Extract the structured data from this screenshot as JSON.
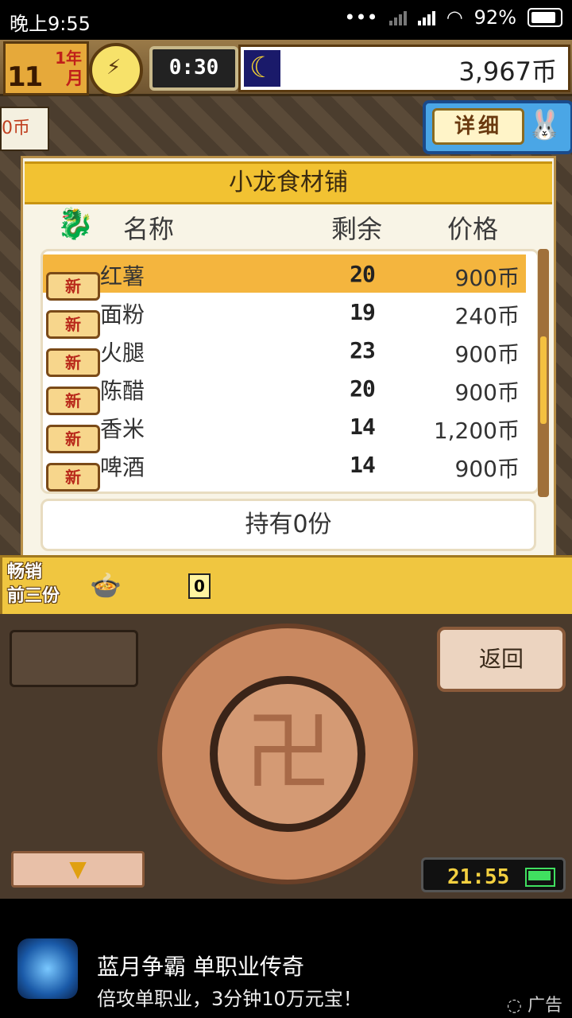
{
  "status_bar": {
    "time": "晚上9:55",
    "battery": "92%"
  },
  "topbar": {
    "year_num": "1",
    "year_unit": "年",
    "month_num": "11",
    "month_unit": "月",
    "timer": "0:30",
    "money": "3,967币",
    "detail_label": "详细"
  },
  "side_label": "0币",
  "shop": {
    "title": "小龙食材铺",
    "headers": {
      "name": "名称",
      "remaining": "剩余",
      "price": "价格"
    },
    "badge": "新",
    "items": [
      {
        "name": "红薯",
        "qty": "20",
        "price": "900币",
        "selected": true
      },
      {
        "name": "面粉",
        "qty": "19",
        "price": "240币",
        "selected": false
      },
      {
        "name": "火腿",
        "qty": "23",
        "price": "900币",
        "selected": false
      },
      {
        "name": "陈醋",
        "qty": "20",
        "price": "900币",
        "selected": false
      },
      {
        "name": "香米",
        "qty": "14",
        "price": "1,200币",
        "selected": false
      },
      {
        "name": "啤酒",
        "qty": "14",
        "price": "900币",
        "selected": false
      }
    ],
    "owned": "持有0份"
  },
  "best_sellers": {
    "label_line1": "畅销",
    "label_line2": "前三份",
    "count": "0"
  },
  "controls": {
    "back": "返回",
    "clock": "21:55"
  },
  "ad": {
    "title": "蓝月争霸 单职业传奇",
    "subtitle": "倍攻单职业，3分钟10万元宝！",
    "tag": "广告"
  }
}
